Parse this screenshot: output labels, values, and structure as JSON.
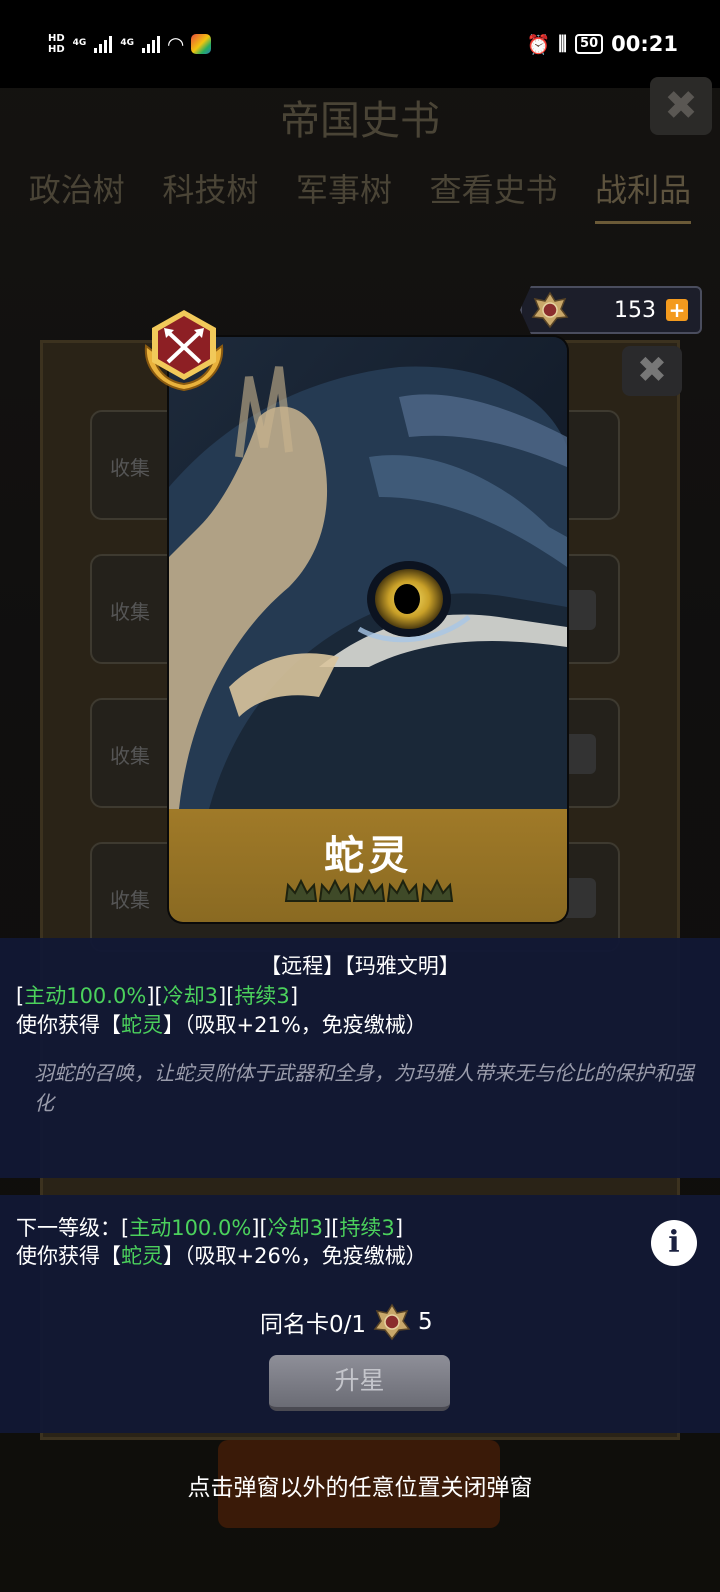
{
  "status_bar": {
    "hd1": "HD",
    "hd2": "HD",
    "sig1": "4G",
    "sig2": "4G",
    "battery": "50",
    "time": "00:21"
  },
  "background": {
    "title": "帝国史书",
    "tabs": [
      "政治树",
      "科技树",
      "军事树",
      "查看史书",
      "战利品"
    ],
    "row_label": "收集"
  },
  "currency": {
    "value": "153",
    "plus": "+"
  },
  "card": {
    "name": "蛇灵",
    "stars_total": 5,
    "stars_filled": 0
  },
  "info": {
    "tags": "【远程】【玛雅文明】",
    "stats_line": {
      "b1": "[",
      "active": "主动100.0%",
      "b2": "][",
      "cooldown": "冷却3",
      "b3": "][",
      "duration": "持续3",
      "b4": "]"
    },
    "effect_line": {
      "prefix": "使你获得【",
      "buff": "蛇灵",
      "suffix": "】（吸取+21%，免疫缴械）"
    },
    "flavor": "羽蛇的召唤，让蛇灵附体于武器和全身，为玛雅人带来无与伦比的保护和强化"
  },
  "next_level": {
    "label": "下一等级：",
    "b1": "[",
    "active": "主动100.0%",
    "b2": "][",
    "cooldown": "冷却3",
    "b3": "][",
    "duration": "持续3",
    "b4": "]",
    "effect_prefix": "使你获得【",
    "effect_buff": "蛇灵",
    "effect_suffix": "】（吸取+26%，免疫缴械）"
  },
  "duplicate": {
    "label": "同名卡0/1",
    "cost": "5"
  },
  "upgrade_button": "升星",
  "close_hint": "点击弹窗以外的任意位置关闭弹窗",
  "colors": {
    "green": "#4bd15c",
    "gold": "#a07a28",
    "panel": "#121834",
    "plus": "#f39a1e"
  }
}
